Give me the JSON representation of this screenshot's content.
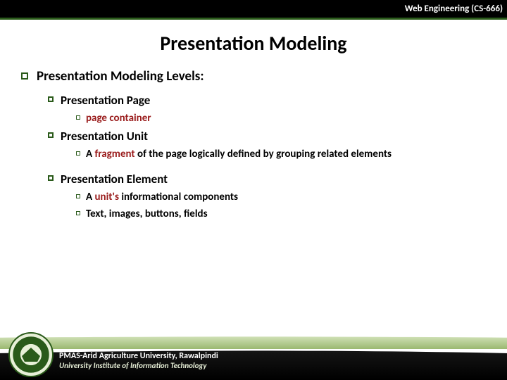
{
  "header": {
    "course": "Web Engineering (CS-666)"
  },
  "title": "Presentation Modeling",
  "content": {
    "heading": "Presentation Modeling Levels:",
    "items": [
      {
        "label": "Presentation Page",
        "sub": [
          {
            "pre": "",
            "hl": "page container",
            "post": ""
          }
        ]
      },
      {
        "label": "Presentation Unit",
        "sub": [
          {
            "pre": "A ",
            "hl": "fragment",
            "post": " of the page logically defined by grouping related elements"
          }
        ]
      },
      {
        "label": "Presentation Element",
        "sub": [
          {
            "pre": "A ",
            "hl": "unit's",
            "post": " informational components"
          },
          {
            "pre": "Text, images, buttons, fields",
            "hl": "",
            "post": ""
          }
        ]
      }
    ]
  },
  "footer": {
    "line1": "PMAS-Arid Agriculture University, Rawalpindi",
    "line2": "University Institute of Information Technology"
  }
}
